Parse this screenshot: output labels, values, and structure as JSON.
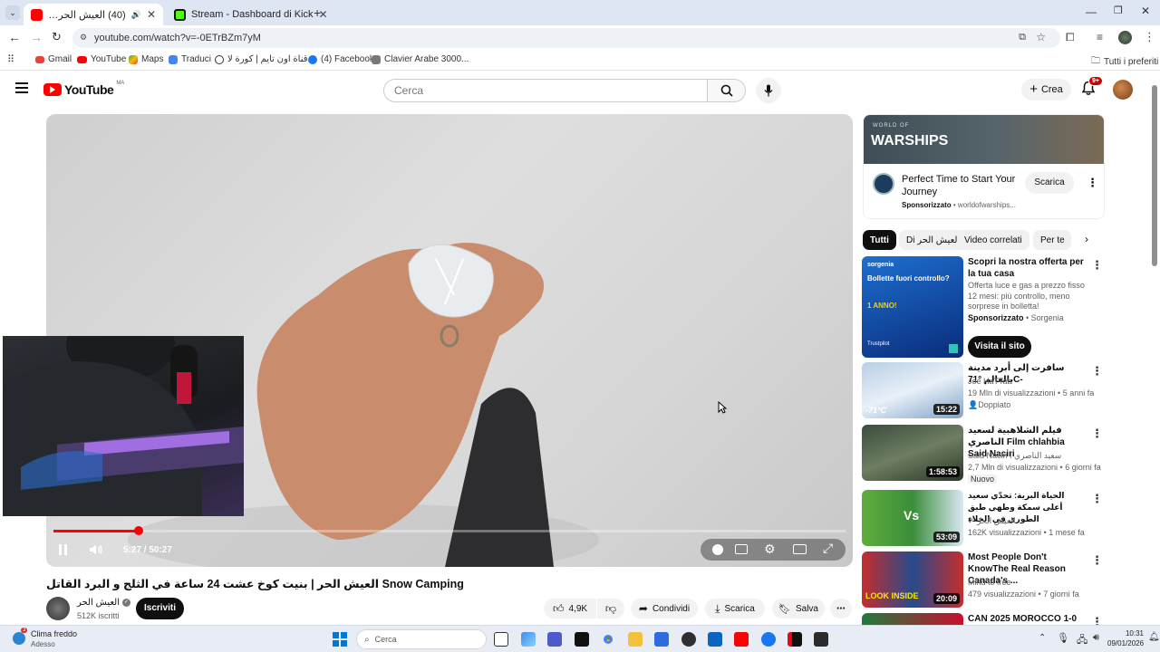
{
  "browser": {
    "tabs": [
      {
        "label": "(40) العيش الحر | بنيت كوخ ع",
        "favicon": "youtube-icon",
        "active": true
      },
      {
        "label": "Stream - Dashboard di Kick",
        "favicon": "kick-icon",
        "active": false
      }
    ],
    "url": "youtube.com/watch?v=-0ETrBZm7yM",
    "bookmarks": [
      "Gmail",
      "YouTube",
      "Maps",
      "Traduci",
      "قناة اون تايم | كورة لا...",
      "(4) Facebook",
      "Clavier Arabe 3000..."
    ],
    "all_bookmarks_label": "Tutti i preferiti"
  },
  "youtube": {
    "logo_text": "YouTube",
    "region": "MA",
    "search_placeholder": "Cerca",
    "create_label": "Crea",
    "notifications_badge": "9+"
  },
  "player": {
    "time": "5:27 / 50:27",
    "progress": 0.108
  },
  "video": {
    "title": "العيش الحر | بنيت كوخ عشت 24 ساعة في الثلج و البرد القاتل Snow Camping",
    "channel": "العيش الحر",
    "subscribers": "512K iscritti",
    "subscribe_label": "Iscriviti",
    "likes": "4,9K",
    "share_label": "Condividi",
    "download_label": "Scarica",
    "save_label": "Salva"
  },
  "ad": {
    "banner_text": "WARSHIPS",
    "banner_small": "WORLD OF",
    "title": "Perfect Time to Start Your Journey",
    "sponsor_label": "Sponsorizzato",
    "domain": "worldofwarships...",
    "cta": "Scarica"
  },
  "chips": [
    "Tutti",
    "Di العيش الحر",
    "Video correlati",
    "Per te"
  ],
  "recommendations": [
    {
      "title": "Scopri la nostra offerta per la tua casa",
      "desc": "Offerta luce e gas a prezzo fisso 12 mesi: più controllo, meno sorprese in bolletta!",
      "sponsored": "Sponsorizzato",
      "advertiser": "Sorgenia",
      "cta": "Visita il sito",
      "thumb_heading": "Bollette fuori controllo?",
      "thumb_brand": "sorgenia",
      "thumb_year": "1 ANNO!",
      "thumb_rating": "Trustpilot"
    },
    {
      "title": "سافرت إلى أبرد مدينة بالعالم °71C-",
      "channel": "Joe HaTTab",
      "stats": "19 Mln di visualizzazioni • 5 anni fa",
      "badge": "Doppiato",
      "duration": "15:22",
      "overlay": "-71°C"
    },
    {
      "title": "فيلم الشلاهبية لسعيد الناصري Film chlahbia Said Naciri",
      "channel": "Said Naciri I سعيد الناصري",
      "stats": "2,7 Mln di visualizzazioni • 6 giorni fa",
      "badge": "Nuovo",
      "duration": "1:58:53"
    },
    {
      "title": "الحياة البرية: تحدّي سعيد أعلى سمكة وطهي طبق الطوري في الخلاء",
      "channel": "العيش الحر",
      "stats": "162K visualizzazioni • 1 mese fa",
      "duration": "53:09",
      "overlay": "Vs"
    },
    {
      "title": "Most People Don't KnowThe Real Reason Canada's ...",
      "channel": "Mind to free",
      "stats": "479 visualizzazioni • 7 giorni fa",
      "duration": "20:09",
      "overlay": "LOOK INSIDE"
    },
    {
      "title": "CAN 2025 MOROCCO 1-0"
    }
  ],
  "taskbar": {
    "weather_title": "Clima freddo",
    "weather_sub": "Adesso",
    "weather_badge": "3",
    "search_placeholder": "Cerca",
    "time": "10:31",
    "date": "09/01/2026"
  }
}
